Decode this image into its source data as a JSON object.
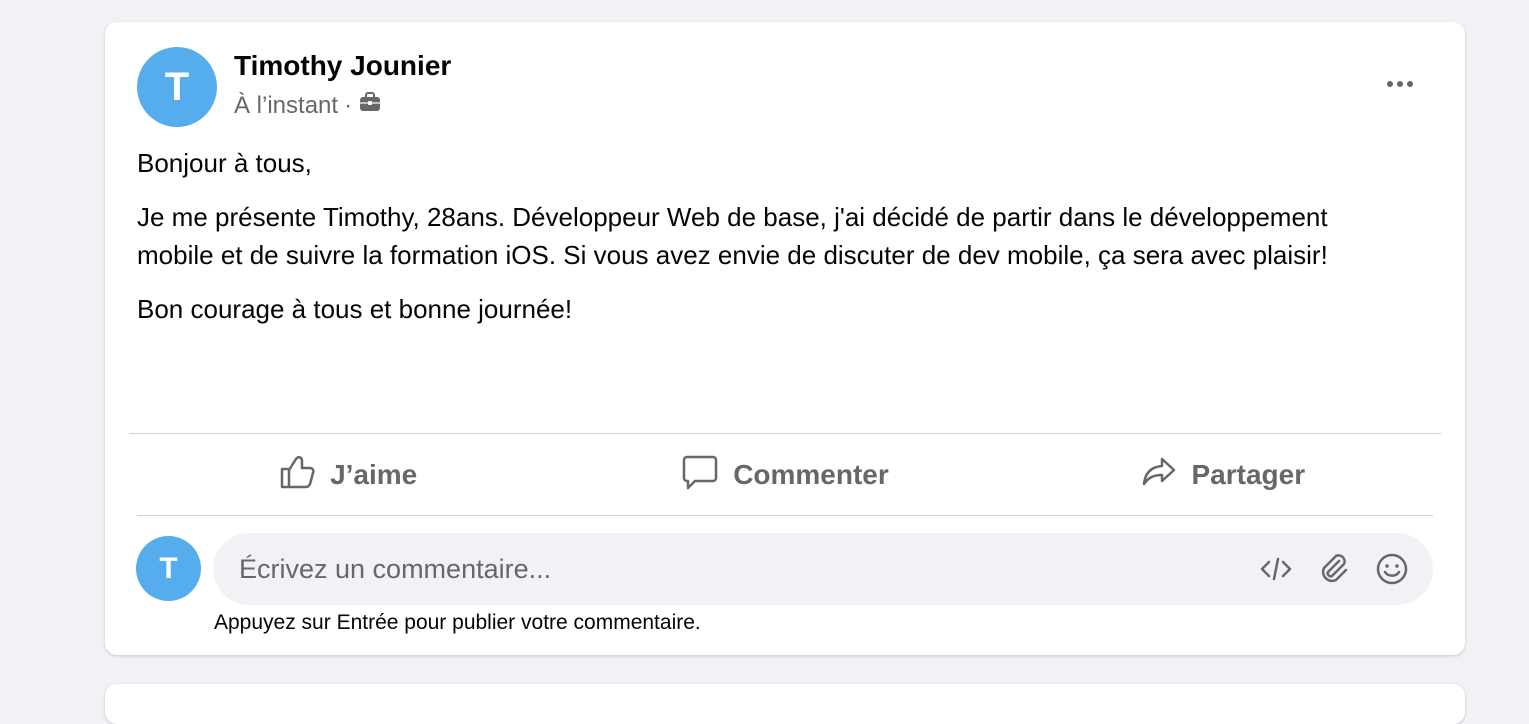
{
  "post": {
    "author": {
      "name": "Timothy Jounier",
      "avatar_letter": "T"
    },
    "timestamp": "À l’instant",
    "separator": "·",
    "audience_icon": "briefcase-icon",
    "more_icon": "more-horizontal-icon",
    "body": [
      "Bonjour à tous,",
      "Je me présente Timothy, 28ans. Développeur Web de base, j'ai décidé de partir dans le développement mobile et de suivre la formation iOS. Si vous avez envie de discuter de dev mobile, ça sera avec plaisir!",
      "Bon courage à tous et bonne journée!"
    ],
    "actions": {
      "like": {
        "label": "J’aime",
        "icon": "thumbs-up-icon"
      },
      "comment": {
        "label": "Commenter",
        "icon": "speech-bubble-icon"
      },
      "share": {
        "label": "Partager",
        "icon": "share-arrow-icon"
      }
    }
  },
  "comment_composer": {
    "avatar_letter": "T",
    "placeholder": "Écrivez un commentaire...",
    "tools": [
      "code-icon",
      "paperclip-icon",
      "smiley-icon"
    ],
    "hint": "Appuyez sur Entrée pour publier votre commentaire."
  },
  "colors": {
    "background": "#f0f2f5",
    "card": "#ffffff",
    "avatar": "#55adee",
    "secondary_text": "#65676b",
    "primary_text": "#050505"
  }
}
